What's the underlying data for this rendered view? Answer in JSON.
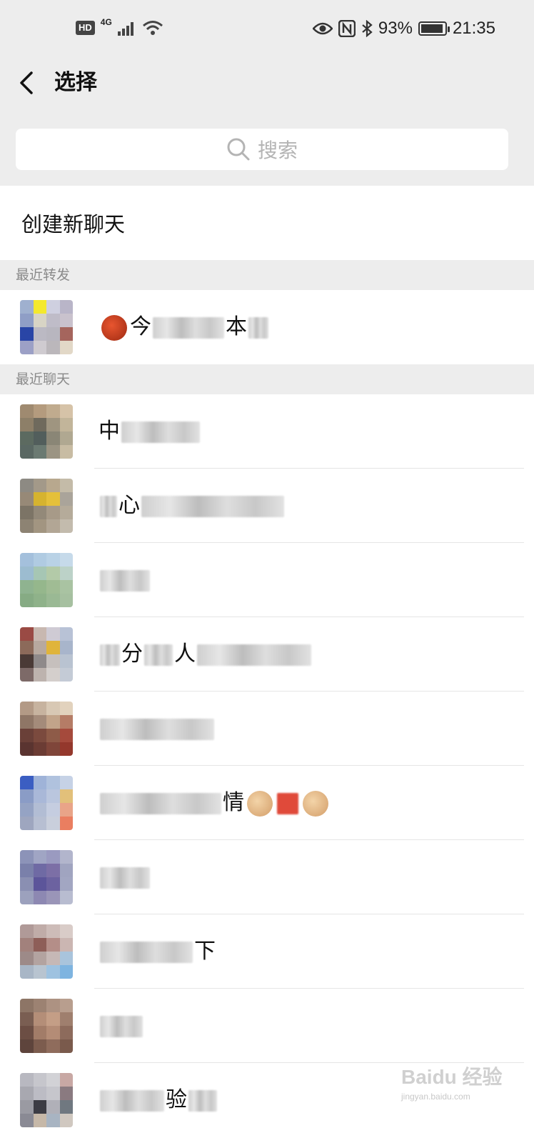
{
  "status_bar": {
    "hd": "HD",
    "network": "4G",
    "battery": "93%",
    "battery_level": 0.93,
    "time": "21:35",
    "icons": [
      "signal-icon",
      "wifi-icon",
      "eye-icon",
      "nfc-icon",
      "bluetooth-icon",
      "battery-icon"
    ]
  },
  "header": {
    "title": "选择",
    "back_icon": "chevron-left-icon"
  },
  "search": {
    "placeholder": "搜索",
    "icon": "search-icon"
  },
  "create_new_chat": "创建新聊天",
  "sections": {
    "recent_forward": "最近转发",
    "recent_chats": "最近聊天"
  },
  "recent_forward_items": [
    {
      "name_prefix": "今",
      "name_suffix": "本",
      "emoji": "ogre-emoji"
    }
  ],
  "recent_chat_items": [
    {
      "name_prefix": "中",
      "name_suffix": ""
    },
    {
      "name_prefix": "心",
      "name_suffix": ""
    },
    {
      "name_prefix": "",
      "name_suffix": ""
    },
    {
      "name_prefix": "分",
      "name_suffix": "人"
    },
    {
      "name_prefix": "",
      "name_suffix": ""
    },
    {
      "name_prefix": "",
      "name_suffix": "情"
    },
    {
      "name_prefix": "",
      "name_suffix": ""
    },
    {
      "name_prefix": "",
      "name_suffix": "下"
    },
    {
      "name_prefix": "",
      "name_suffix": ""
    },
    {
      "name_prefix": "",
      "name_suffix": "验"
    }
  ],
  "watermark": {
    "brand": "Baidu 经验",
    "url": "jingyan.baidu.com"
  },
  "colors": {
    "header_bg": "#ededed",
    "divider": "#e5e5e5",
    "placeholder": "#b4b4b4"
  }
}
